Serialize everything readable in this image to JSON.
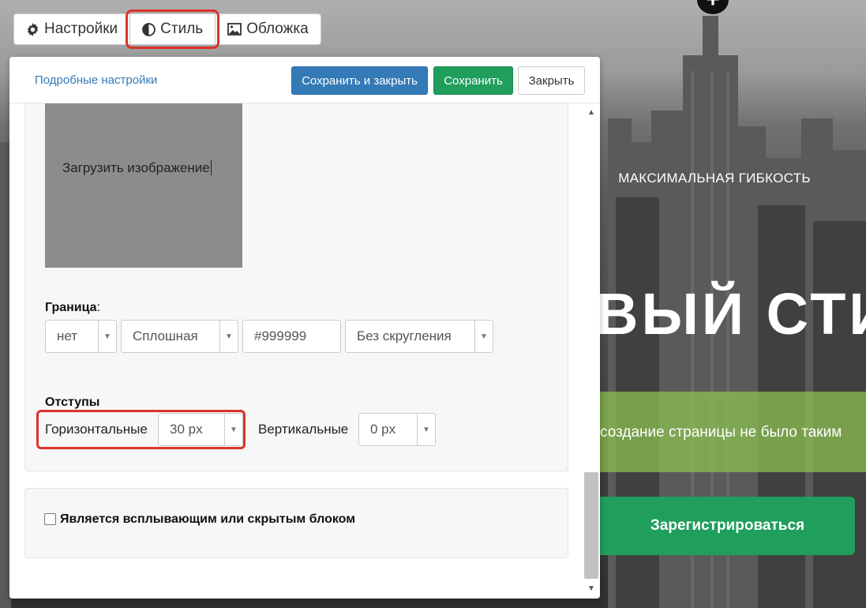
{
  "tabs": [
    {
      "label": "Настройки",
      "icon": "gear-icon"
    },
    {
      "label": "Стиль",
      "icon": "contrast-icon"
    },
    {
      "label": "Обложка",
      "icon": "image-icon"
    }
  ],
  "header": {
    "advanced_link": "Подробные настройки",
    "save_close_label": "Сохранить и закрыть",
    "save_label": "Сохранить",
    "close_label": "Закрыть"
  },
  "upload": {
    "label": "Загрузить изображение"
  },
  "border": {
    "label": "Граница",
    "label_suffix": ":",
    "width_value": "нет",
    "style_value": "Сплошная",
    "color_value": "#999999",
    "radius_value": "Без скругления"
  },
  "padding": {
    "label": "Отступы",
    "horizontal_label": "Горизонтальные",
    "horizontal_value": "30 px",
    "vertical_label": "Вертикальные",
    "vertical_value": "0 px"
  },
  "popup": {
    "checkbox_label": "Является всплывающим или скрытым блоком",
    "checked": false
  },
  "hero": {
    "kicker": "МАКСИМАЛЬНАЯ ГИБКОСТЬ",
    "title": "ВЫЙ СТИЛ",
    "subtitle": "создание страницы не было таким",
    "cta_label": "Зарегистрироваться",
    "add_symbol": "+"
  },
  "colors": {
    "primary": "#337ab7",
    "success": "#1f9e5c",
    "highlight": "#d9342b",
    "hero_band": "#8cc350"
  }
}
